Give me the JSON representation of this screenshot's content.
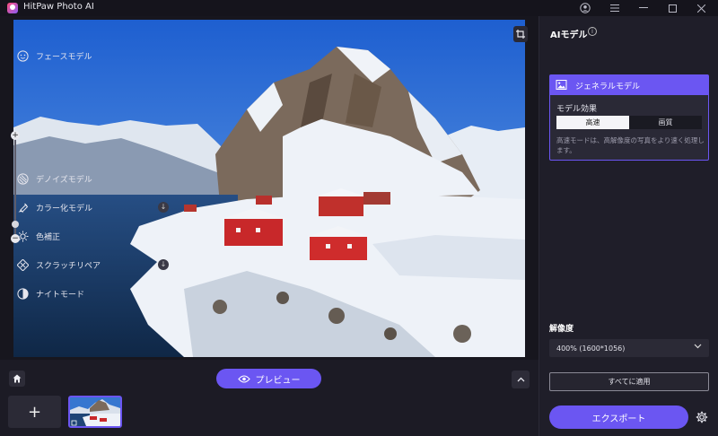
{
  "app": {
    "title": "HitPaw Photo AI"
  },
  "titlebar": {
    "icons": [
      "user-icon",
      "menu-icon",
      "minimize-icon",
      "maximize-icon",
      "close-icon"
    ]
  },
  "canvas": {
    "image_description_colors": {
      "sky": "#2f6fd8",
      "snow": "#eef2f8",
      "houses": "#c8282a",
      "water": "#1a3a63",
      "rock": "#6b5a4c"
    }
  },
  "bottom": {
    "preview_label": "プレビュー",
    "add_label": "+"
  },
  "panel": {
    "title": "AIモデル",
    "models": [
      {
        "label": "フェースモデル",
        "icon": "face-icon"
      },
      {
        "label": "ジェネラルモデル",
        "icon": "image-icon",
        "selected": true
      },
      {
        "label": "デノイズモデル",
        "icon": "denoise-icon"
      },
      {
        "label": "カラー化モデル",
        "icon": "colorize-icon",
        "download": true
      },
      {
        "label": "色補正",
        "icon": "sun-icon"
      },
      {
        "label": "スクラッチリペア",
        "icon": "scratch-icon",
        "download": true
      },
      {
        "label": "ナイトモード",
        "icon": "night-icon"
      }
    ],
    "general": {
      "effect_label": "モデル効果",
      "options": [
        "高速",
        "画質"
      ],
      "selected_option": "高速",
      "description": "高速モードは、高解像度の写真をより速く処理します。"
    },
    "resolution": {
      "label": "解像度",
      "value": "400% (1600*1056)"
    },
    "apply_all_label": "すべてに適用",
    "export_label": "エクスポート"
  },
  "colors": {
    "accent": "#6b56f2",
    "panel_bg": "#1f1e29",
    "app_bg": "#1c1b25"
  }
}
